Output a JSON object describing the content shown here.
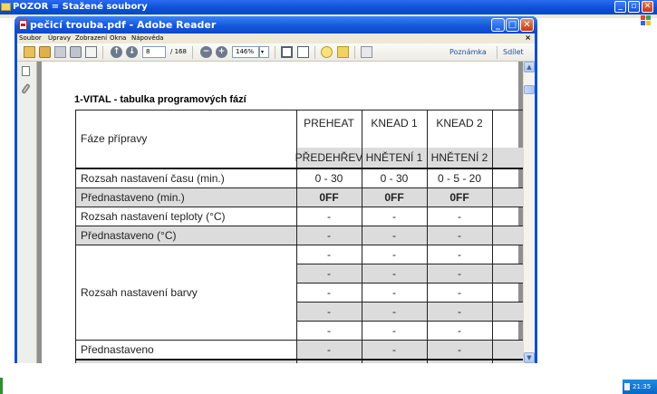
{
  "desktop": {
    "explorer_title": "POZOR = Stažené soubory",
    "clock": "21:35"
  },
  "reader": {
    "title": "pečicí trouba.pdf - Adobe Reader",
    "menu": [
      "Soubor",
      "Úpravy",
      "Zobrazení",
      "Okna",
      "Nápověda"
    ],
    "doc_close": "×",
    "toolbar": {
      "current_page": "8",
      "page_total": "/ 168",
      "zoom": "146%",
      "annotate_label": "Poznámka",
      "share_label": "Sdílet"
    }
  },
  "document": {
    "heading": "1-VITAL - tabulka programových fází",
    "phase_label": "Fáze přípravy",
    "columns": [
      {
        "top": "PREHEAT",
        "bottom": "PŘEDEHŘEV"
      },
      {
        "top": "KNEAD 1",
        "bottom": "HNĚTENÍ 1"
      },
      {
        "top": "KNEAD 2",
        "bottom": "HNĚTENÍ 2"
      },
      {
        "top": "",
        "bottom": ""
      }
    ],
    "rows": [
      {
        "label": "Rozsah nastavení času (min.)",
        "values": [
          "0 - 30",
          "0 - 30",
          "0 - 5 - 20"
        ],
        "shaded": false,
        "bold": false
      },
      {
        "label": "Přednastaveno (min.)",
        "values": [
          "0FF",
          "0FF",
          "0FF"
        ],
        "shaded": true,
        "bold": true
      },
      {
        "label": "Rozsah nastavení teploty (°C)",
        "values": [
          "-",
          "-",
          "-"
        ],
        "shaded": false,
        "bold": false
      },
      {
        "label": "Přednastaveno (°C)",
        "values": [
          "-",
          "-",
          "-"
        ],
        "shaded": true,
        "bold": false
      }
    ],
    "color_block": {
      "label": "Rozsah nastavení barvy",
      "subrows": [
        [
          "-",
          "-",
          "-"
        ],
        [
          "-",
          "-",
          "-"
        ],
        [
          "-",
          "-",
          "-"
        ],
        [
          "-",
          "-",
          "-"
        ],
        [
          "-",
          "-",
          "-"
        ]
      ]
    },
    "last_row": {
      "label": "Přednastaveno",
      "values": [
        "-",
        "-",
        "-"
      ]
    }
  }
}
